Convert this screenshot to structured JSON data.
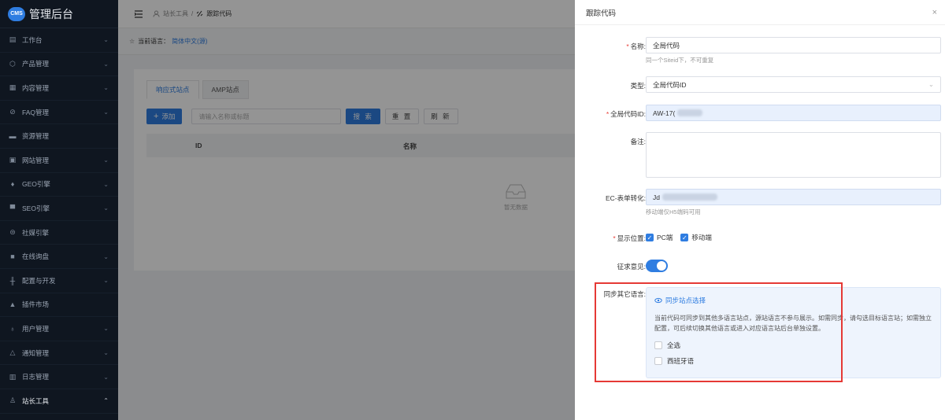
{
  "app": {
    "logo_badge": "CMS",
    "title": "管理后台"
  },
  "sidebar": {
    "items": [
      {
        "label": "工作台",
        "icon": "dashboard-icon",
        "chevron": "⌄"
      },
      {
        "label": "产品管理",
        "icon": "box-icon",
        "chevron": "⌄"
      },
      {
        "label": "内容管理",
        "icon": "document-icon",
        "chevron": "⌄"
      },
      {
        "label": "FAQ管理",
        "icon": "faq-icon",
        "chevron": "⌄"
      },
      {
        "label": "资源管理",
        "icon": "resource-icon",
        "chevron": ""
      },
      {
        "label": "网站管理",
        "icon": "website-icon",
        "chevron": "⌄"
      },
      {
        "label": "GEO引擎",
        "icon": "geo-icon",
        "chevron": "⌄"
      },
      {
        "label": "SEO引擎",
        "icon": "seo-icon",
        "chevron": "⌄"
      },
      {
        "label": "社媒引擎",
        "icon": "social-icon",
        "chevron": ""
      },
      {
        "label": "在线询盘",
        "icon": "chat-icon",
        "chevron": "⌄"
      },
      {
        "label": "配置与开发",
        "icon": "sliders-icon",
        "chevron": "⌄"
      },
      {
        "label": "插件市场",
        "icon": "plugin-icon",
        "chevron": ""
      },
      {
        "label": "用户管理",
        "icon": "user-icon",
        "chevron": "⌄"
      },
      {
        "label": "通知管理",
        "icon": "bell-icon",
        "chevron": "⌄"
      },
      {
        "label": "日志管理",
        "icon": "log-icon",
        "chevron": "⌄"
      },
      {
        "label": "站长工具",
        "icon": "user-tools-icon",
        "chevron": "⌃",
        "active": true
      }
    ]
  },
  "breadcrumb": {
    "parent": "站长工具",
    "sep": "/",
    "current": "跟踪代码"
  },
  "language": {
    "label": "当前语言：",
    "value": "简体中文(源)"
  },
  "tabs": [
    "响应式站点",
    "AMP站点"
  ],
  "toolbar": {
    "add": "添加",
    "search_placeholder": "请输入名称或标题",
    "search": "搜 索",
    "reset": "重 置",
    "refresh": "刷 新"
  },
  "table": {
    "columns": [
      "ID",
      "名称"
    ],
    "empty": "暂无数据"
  },
  "drawer": {
    "title": "跟踪代码",
    "close": "×",
    "name_label": "名称:",
    "name_value": "全局代码",
    "name_hint": "同一个Siteid下，不可重复",
    "type_label": "类型:",
    "type_value": "全局代码ID",
    "gid_label": "全局代码ID:",
    "gid_value": "AW-17(",
    "remark_label": "备注:",
    "ec_label": "EC-表单转化:",
    "ec_value": "Jd",
    "ec_hint": "移动端仅H5端码可用",
    "display_label": "显示位置:",
    "display_pc": "PC端",
    "display_mobile": "移动端",
    "consent_label": "征求意见:",
    "sync_label": "同步其它语言:",
    "sync_link": "同步站点选择",
    "sync_desc": "当前代码可同步到其他多语言站点，源站语言不参与展示。如需同步，请勾选目标语言站；如需独立配置，可后续切换其他语言或进入对应语言站后台单独设置。",
    "opt_all": "全选",
    "opt_es": "西班牙语"
  }
}
